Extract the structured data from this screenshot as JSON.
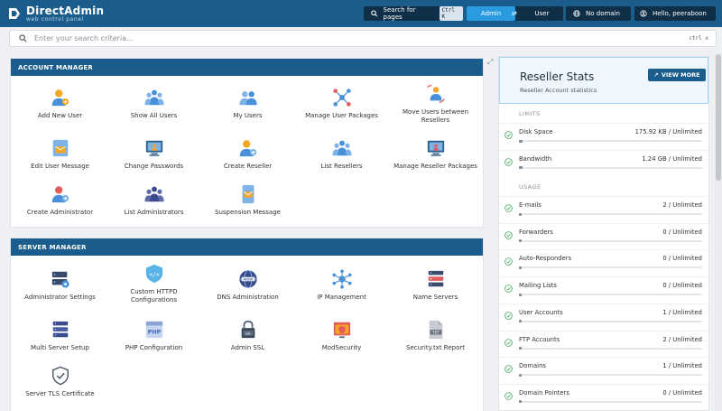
{
  "header": {
    "logo_title": "DirectAdmin",
    "logo_subtitle": "web control panel",
    "search_pages_label": "Search for pages",
    "search_pages_shortcut": "Ctrl K",
    "role_admin": "Admin",
    "role_user": "User",
    "domain_selector": "No domain",
    "user_greeting": "Hello, peeraboon"
  },
  "search": {
    "placeholder": "Enter your search criteria...",
    "shortcut": "ctrl x"
  },
  "account_manager": {
    "title": "ACCOUNT MANAGER",
    "items": [
      {
        "label": "Add New User",
        "icon": "add-user-icon"
      },
      {
        "label": "Show All Users",
        "icon": "users-group-icon"
      },
      {
        "label": "My Users",
        "icon": "users-icon"
      },
      {
        "label": "Manage User Packages",
        "icon": "user-packages-icon"
      },
      {
        "label": "Move Users between Resellers",
        "icon": "move-users-icon"
      },
      {
        "label": "Edit User Message",
        "icon": "user-message-icon"
      },
      {
        "label": "Change Passwords",
        "icon": "change-password-icon"
      },
      {
        "label": "Create Reseller",
        "icon": "create-reseller-icon"
      },
      {
        "label": "List Resellers",
        "icon": "list-resellers-icon"
      },
      {
        "label": "Manage Reseller Packages",
        "icon": "reseller-packages-icon"
      },
      {
        "label": "Create Administrator",
        "icon": "create-admin-icon"
      },
      {
        "label": "List Administrators",
        "icon": "list-admins-icon"
      },
      {
        "label": "Suspension Message",
        "icon": "suspension-message-icon"
      }
    ]
  },
  "server_manager": {
    "title": "SERVER MANAGER",
    "items": [
      {
        "label": "Administrator Settings",
        "icon": "admin-settings-icon"
      },
      {
        "label": "Custom HTTPD Configurations",
        "icon": "httpd-config-icon"
      },
      {
        "label": "DNS Administration",
        "icon": "dns-icon"
      },
      {
        "label": "IP Management",
        "icon": "ip-management-icon"
      },
      {
        "label": "Name Servers",
        "icon": "name-servers-icon"
      },
      {
        "label": "Multi Server Setup",
        "icon": "multi-server-icon"
      },
      {
        "label": "PHP Configuration",
        "icon": "php-icon"
      },
      {
        "label": "Admin SSL",
        "icon": "ssl-lock-icon"
      },
      {
        "label": "ModSecurity",
        "icon": "modsecurity-icon"
      },
      {
        "label": "Security.txt Report",
        "icon": "security-txt-icon"
      },
      {
        "label": "Server TLS Certificate",
        "icon": "tls-shield-icon"
      }
    ]
  },
  "reseller_stats": {
    "title": "Reseller Stats",
    "subtitle": "Reseller Account statistics",
    "view_more": "VIEW MORE",
    "limits_label": "LIMITS",
    "usage_label": "USAGE",
    "limits": [
      {
        "label": "Disk Space",
        "value": "175.92 KB / Unlimited",
        "fill": 0.02
      },
      {
        "label": "Bandwidth",
        "value": "1.24 GB / Unlimited",
        "fill": 0.02
      }
    ],
    "usage": [
      {
        "label": "E-mails",
        "value": "2 / Unlimited",
        "fill": 0.01
      },
      {
        "label": "Forwarders",
        "value": "0 / Unlimited",
        "fill": 0.01
      },
      {
        "label": "Auto-Responders",
        "value": "0 / Unlimited",
        "fill": 0.01
      },
      {
        "label": "Mailing Lists",
        "value": "0 / Unlimited",
        "fill": 0.01
      },
      {
        "label": "User Accounts",
        "value": "1 / Unlimited",
        "fill": 0.01
      },
      {
        "label": "FTP Accounts",
        "value": "2 / Unlimited",
        "fill": 0.01
      },
      {
        "label": "Domains",
        "value": "1 / Unlimited",
        "fill": 0.01
      },
      {
        "label": "Domain Pointers",
        "value": "0 / Unlimited",
        "fill": 0.01
      }
    ]
  },
  "colors": {
    "header_bg": "#1a5d8c",
    "accent": "#2a9be0",
    "icon_blue": "#4a90d9",
    "icon_orange": "#f5a623",
    "icon_red": "#e25c5c",
    "success": "#3aa757"
  }
}
